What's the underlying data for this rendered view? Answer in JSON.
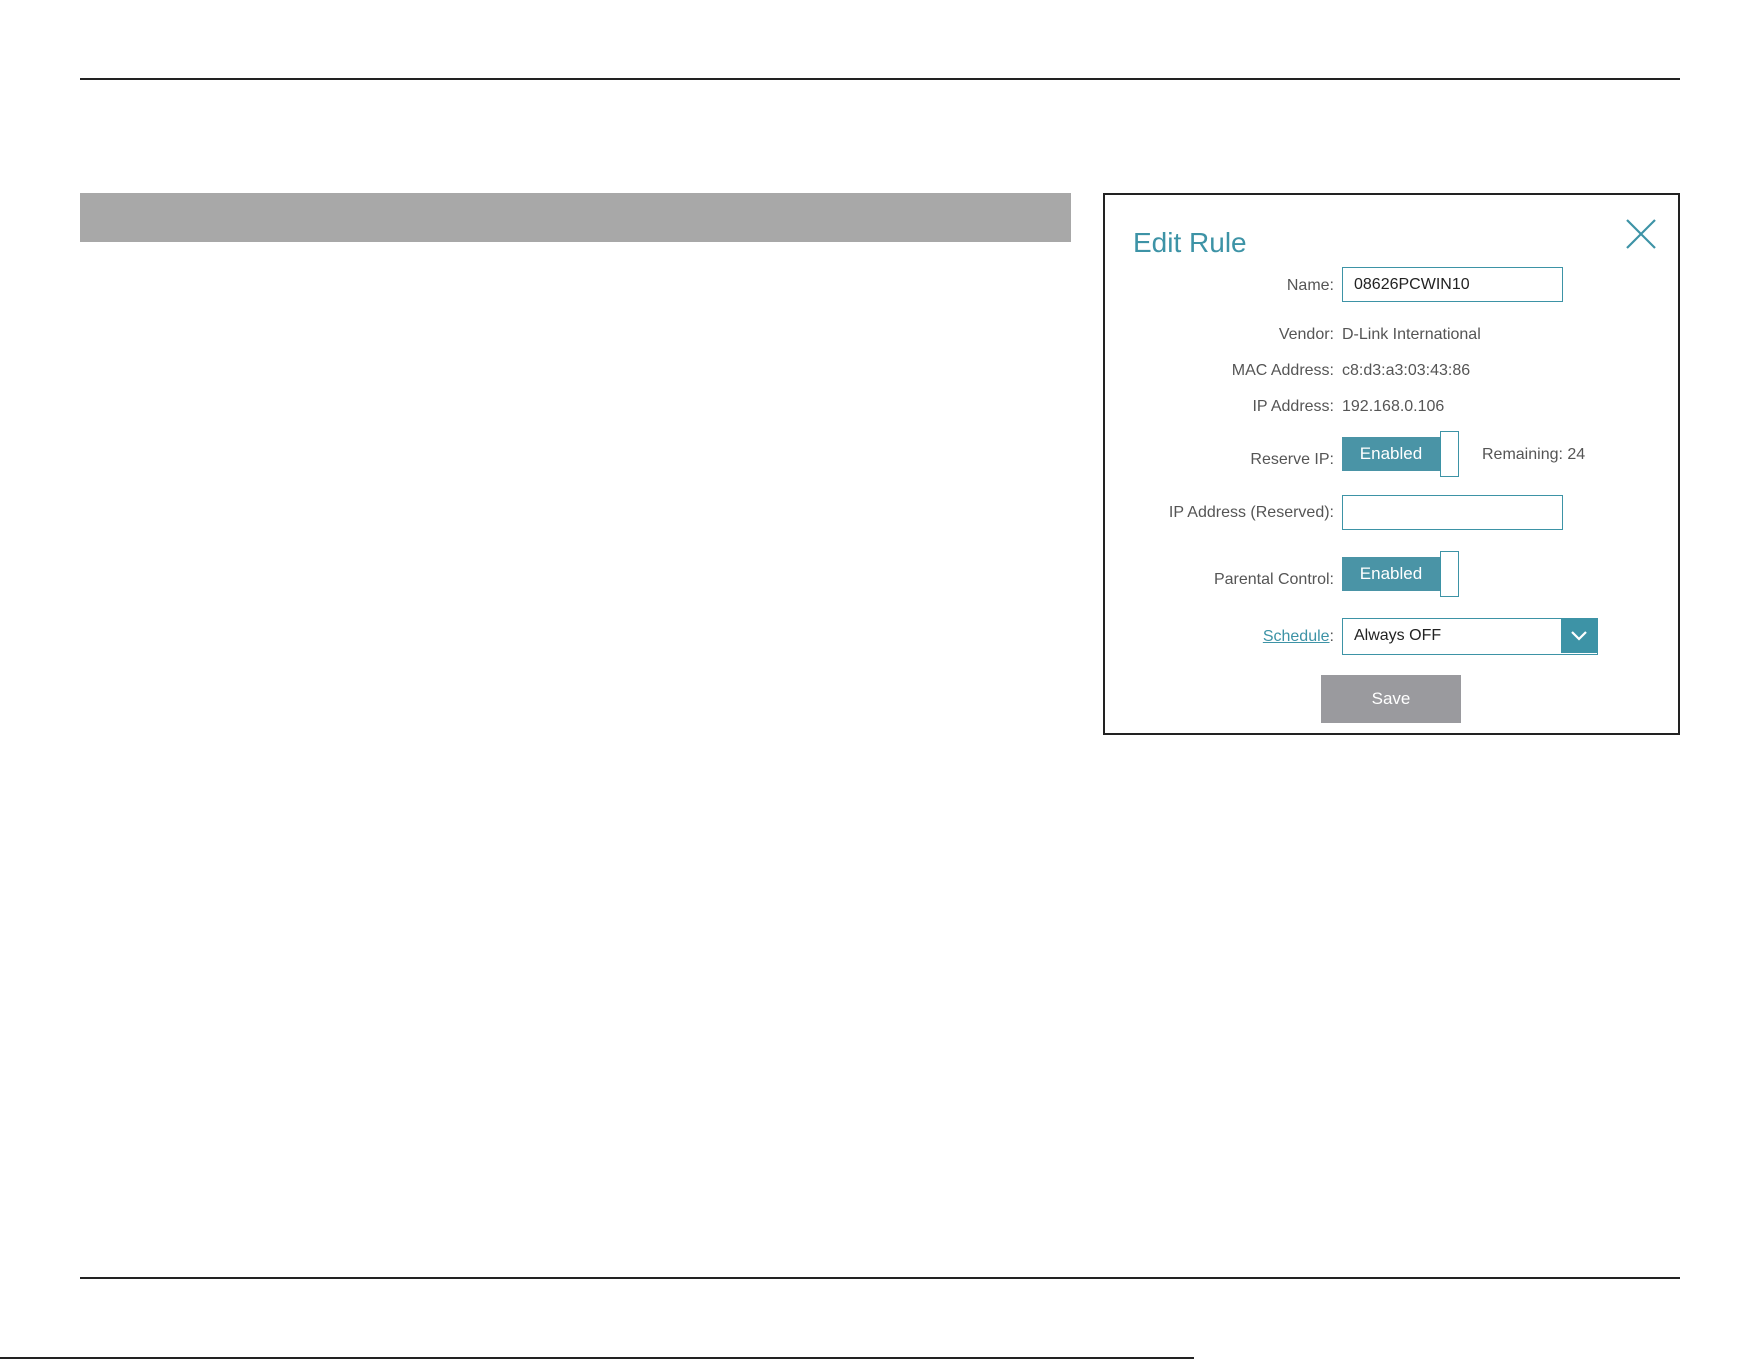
{
  "dialog": {
    "title": "Edit Rule",
    "close_icon": "close-icon",
    "accent_color": "#3d93a6",
    "name": {
      "label": "Name:",
      "value": "08626PCWIN10"
    },
    "vendor": {
      "label": "Vendor:",
      "value": "D-Link International"
    },
    "mac": {
      "label": "MAC Address:",
      "value": "c8:d3:a3:03:43:86"
    },
    "ip": {
      "label": "IP Address:",
      "value": "192.168.0.106"
    },
    "reserve_ip": {
      "label": "Reserve IP:",
      "state": "Enabled",
      "remaining": "Remaining: 24"
    },
    "ip_reserved": {
      "label": "IP Address (Reserved):",
      "value": ""
    },
    "parental_control": {
      "label": "Parental Control:",
      "state": "Enabled"
    },
    "schedule": {
      "label": "Schedule",
      "colon": ":",
      "value": "Always OFF",
      "arrow_icon": "chevron-down-icon"
    },
    "save_label": "Save"
  }
}
